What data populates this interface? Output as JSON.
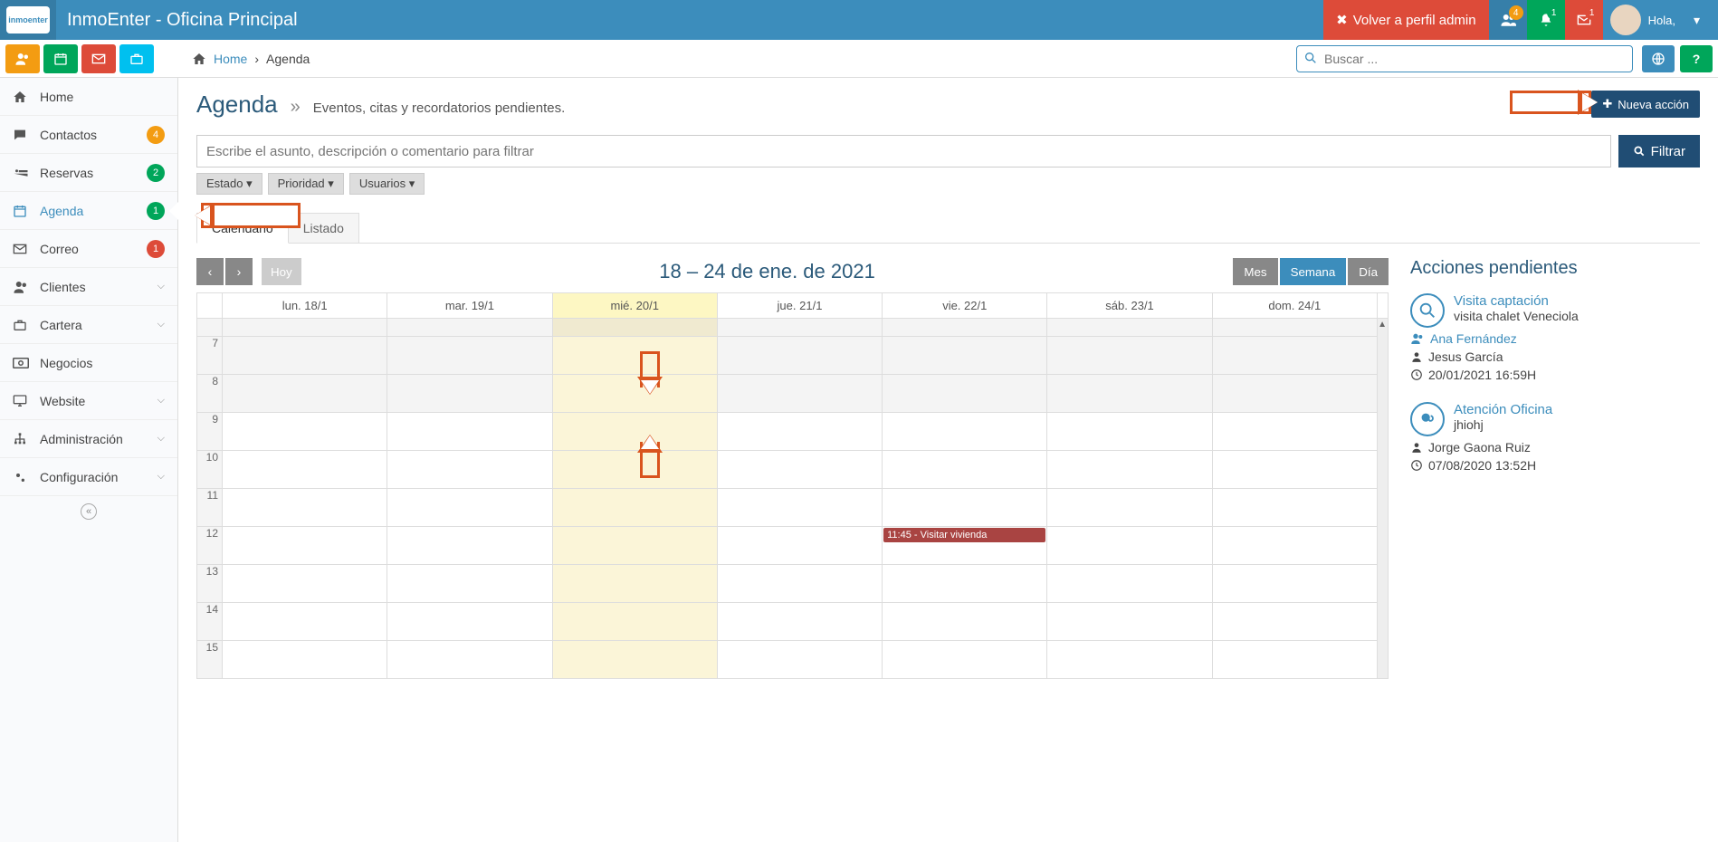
{
  "brand": {
    "logo": "inmoenter",
    "title": "InmoEnter - Oficina Principal"
  },
  "topbar": {
    "back_admin": "Volver a perfil admin",
    "badges": {
      "users": "4",
      "bell": "1",
      "mail": "1"
    },
    "greeting": "Hola,"
  },
  "breadcrumb": {
    "home": "Home",
    "current": "Agenda"
  },
  "search": {
    "placeholder": "Buscar ..."
  },
  "sidebar": {
    "items": [
      {
        "label": "Home"
      },
      {
        "label": "Contactos",
        "badge": "4",
        "badge_color": "orange"
      },
      {
        "label": "Reservas",
        "badge": "2",
        "badge_color": "green"
      },
      {
        "label": "Agenda",
        "badge": "1",
        "badge_color": "green",
        "active": true
      },
      {
        "label": "Correo",
        "badge": "1",
        "badge_color": "red"
      },
      {
        "label": "Clientes",
        "chev": true
      },
      {
        "label": "Cartera",
        "chev": true
      },
      {
        "label": "Negocios"
      },
      {
        "label": "Website",
        "chev": true
      },
      {
        "label": "Administración",
        "chev": true
      },
      {
        "label": "Configuración",
        "chev": true
      }
    ]
  },
  "page": {
    "title": "Agenda",
    "subtitle": "Eventos, citas y recordatorios pendientes.",
    "new_action": "Nueva acción"
  },
  "filter": {
    "placeholder": "Escribe el asunto, descripción o comentario para filtrar",
    "button": "Filtrar",
    "dropdowns": [
      "Estado",
      "Prioridad",
      "Usuarios"
    ]
  },
  "tabs": {
    "calendar": "Calendario",
    "list": "Listado"
  },
  "calendar": {
    "today": "Hoy",
    "title": "18 – 24 de ene. de 2021",
    "views": {
      "month": "Mes",
      "week": "Semana",
      "day": "Día"
    },
    "days": [
      "lun. 18/1",
      "mar. 19/1",
      "mié. 20/1",
      "jue. 21/1",
      "vie. 22/1",
      "sáb. 23/1",
      "dom. 24/1"
    ],
    "hours": [
      "7",
      "8",
      "9",
      "10",
      "11",
      "12",
      "13",
      "14",
      "15"
    ],
    "event": {
      "label": "11:45 - Visitar vivienda"
    }
  },
  "pending": {
    "title": "Acciones pendientes",
    "items": [
      {
        "title": "Visita captación",
        "subtitle": "visita chalet Veneciola",
        "client": "Ana Fernández",
        "agent": "Jesus García",
        "datetime": "20/01/2021 16:59H"
      },
      {
        "title": "Atención Oficina",
        "subtitle": "jhiohj",
        "agent": "Jorge Gaona Ruiz",
        "datetime": "07/08/2020 13:52H"
      }
    ]
  }
}
